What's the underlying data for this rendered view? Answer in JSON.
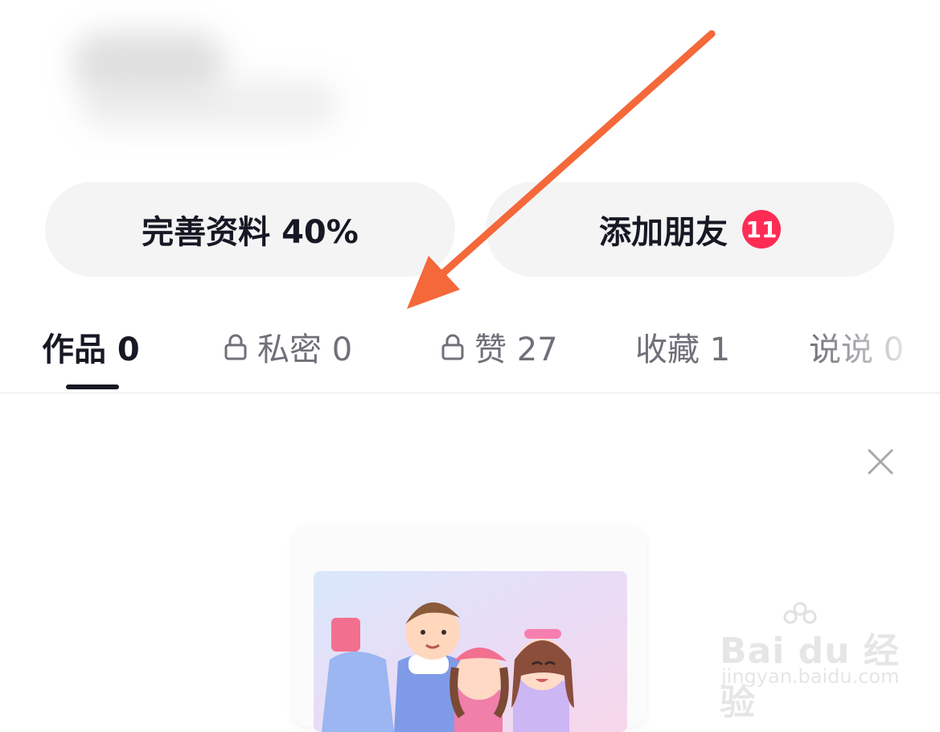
{
  "profile": {
    "complete_label": "完善资料 40%",
    "add_friends_label": "添加朋友",
    "friend_badge": "11"
  },
  "tabs": [
    {
      "label": "作品 0",
      "locked": false,
      "active": true
    },
    {
      "label": "私密 0",
      "locked": true,
      "active": false
    },
    {
      "label": "赞 27",
      "locked": true,
      "active": false
    },
    {
      "label": "收藏 1",
      "locked": false,
      "active": false
    },
    {
      "label": "说说 0",
      "locked": false,
      "active": false
    }
  ],
  "watermark": {
    "brand": "Bai du 经验",
    "url": "jingyan.baidu.com"
  },
  "colors": {
    "accent": "#fe2c55",
    "annotation_arrow": "#f4683a",
    "text_primary": "#161823",
    "text_secondary": "#6f7079"
  }
}
